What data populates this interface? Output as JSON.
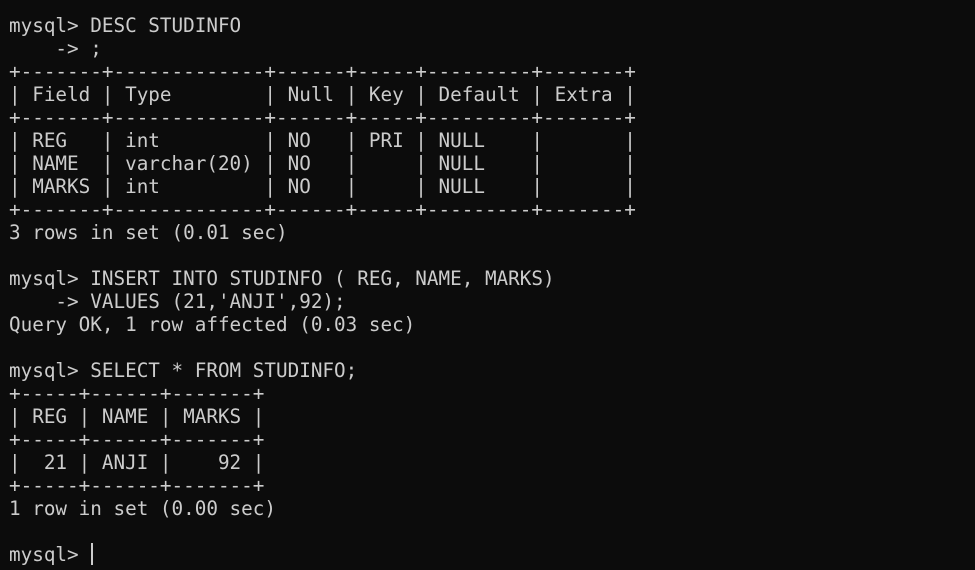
{
  "terminal": {
    "lines": [
      "mysql> DESC STUDINFO",
      "    -> ;",
      "+-------+-------------+------+-----+---------+-------+",
      "| Field | Type        | Null | Key | Default | Extra |",
      "+-------+-------------+------+-----+---------+-------+",
      "| REG   | int         | NO   | PRI | NULL    |       |",
      "| NAME  | varchar(20) | NO   |     | NULL    |       |",
      "| MARKS | int         | NO   |     | NULL    |       |",
      "+-------+-------------+------+-----+---------+-------+",
      "3 rows in set (0.01 sec)",
      "",
      "mysql> INSERT INTO STUDINFO ( REG, NAME, MARKS)",
      "    -> VALUES (21,'ANJI',92);",
      "Query OK, 1 row affected (0.03 sec)",
      "",
      "mysql> SELECT * FROM STUDINFO;",
      "+-----+------+-------+",
      "| REG | NAME | MARKS |",
      "+-----+------+-------+",
      "|  21 | ANJI |    92 |",
      "+-----+------+-------+",
      "1 row in set (0.00 sec)",
      ""
    ],
    "prompt": "mysql> "
  }
}
